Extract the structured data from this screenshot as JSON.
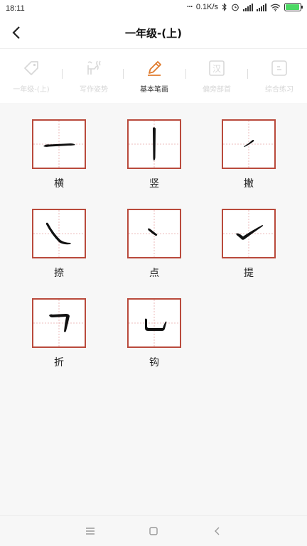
{
  "status": {
    "time": "18:11",
    "net_speed": "0.1K/s"
  },
  "header": {
    "title": "一年级-(上)"
  },
  "tabs": [
    {
      "label": "一年级-(上)",
      "icon": "tag-icon",
      "active": false
    },
    {
      "label": "写作姿势",
      "icon": "posture-icon",
      "active": false
    },
    {
      "label": "基本笔画",
      "icon": "pencil-icon",
      "active": true
    },
    {
      "label": "偏旁部首",
      "icon": "radical-icon",
      "active": false
    },
    {
      "label": "综合练习",
      "icon": "practice-icon",
      "active": false
    }
  ],
  "strokes": [
    {
      "name": "横"
    },
    {
      "name": "竖"
    },
    {
      "name": "撇"
    },
    {
      "name": "捺"
    },
    {
      "name": "点"
    },
    {
      "name": "提"
    },
    {
      "name": "折"
    },
    {
      "name": "钩"
    }
  ],
  "colors": {
    "accent": "#e07b2e",
    "box_border": "#b94a3c",
    "guide": "#e6a8a8",
    "inactive_text": "#d6d6d6"
  }
}
